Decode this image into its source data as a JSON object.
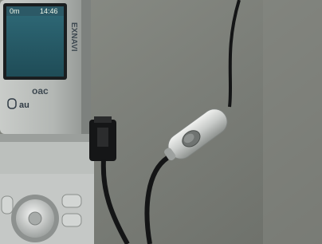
{
  "photo": {
    "screen_status_left": "0m",
    "screen_time": "14:46",
    "brand_vertical": "EXNAVI",
    "logo_text": "oac",
    "carrier": "au"
  }
}
